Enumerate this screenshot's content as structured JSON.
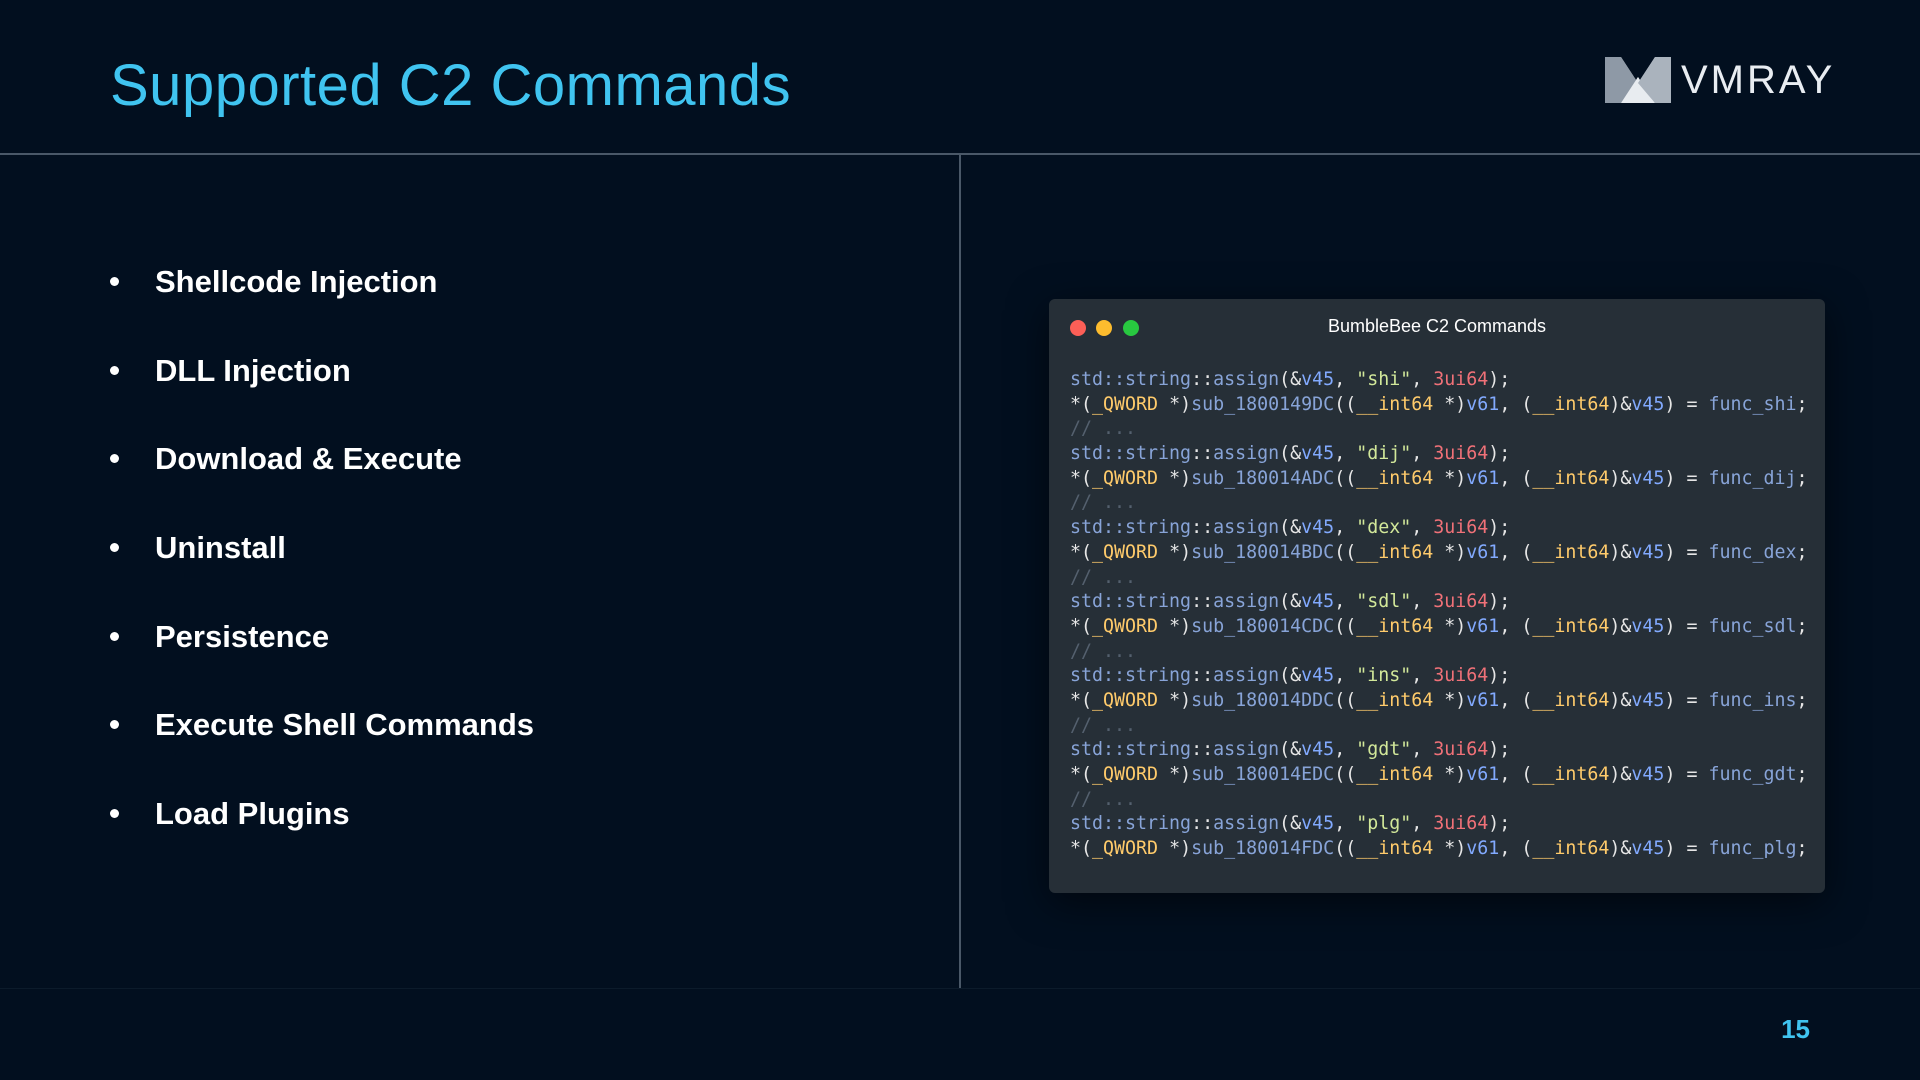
{
  "slide": {
    "title": "Supported C2 Commands",
    "logo_text": "VMRAY",
    "page_number": "15",
    "accent_color": "#40c4f0"
  },
  "bullets": [
    "Shellcode Injection",
    "DLL Injection",
    "Download & Execute",
    "Uninstall",
    "Persistence",
    "Execute Shell Commands",
    "Load Plugins"
  ],
  "code_window": {
    "title": "BumbleBee C2 Commands",
    "comment": "// ...",
    "commands": [
      {
        "cmd": "\"shi\"",
        "sub": "sub_1800149DC",
        "func": "func_shi"
      },
      {
        "cmd": "\"dij\"",
        "sub": "sub_180014ADC",
        "func": "func_dij"
      },
      {
        "cmd": "\"dex\"",
        "sub": "sub_180014BDC",
        "func": "func_dex"
      },
      {
        "cmd": "\"sdl\"",
        "sub": "sub_180014CDC",
        "func": "func_sdl"
      },
      {
        "cmd": "\"ins\"",
        "sub": "sub_180014DDC",
        "func": "func_ins"
      },
      {
        "cmd": "\"gdt\"",
        "sub": "sub_180014EDC",
        "func": "func_gdt"
      },
      {
        "cmd": "\"plg\"",
        "sub": "sub_180014FDC",
        "func": "func_plg"
      }
    ],
    "tokens": {
      "ns": "std::",
      "string": "string",
      "sep": "::",
      "assign": "assign",
      "assign_open": "(&",
      "v45": "v45",
      "comma": ", ",
      "len": "3ui64",
      "close": ");",
      "star_paren": "*(",
      "qword": "_QWORD",
      "star_close": " *)",
      "paren2": "((",
      "int64": "__int64",
      "v61": "v61",
      "comma_paren": ", (",
      "paren_amp": ")&",
      "paren_eq": ") = ",
      "semicolon": ";"
    }
  }
}
